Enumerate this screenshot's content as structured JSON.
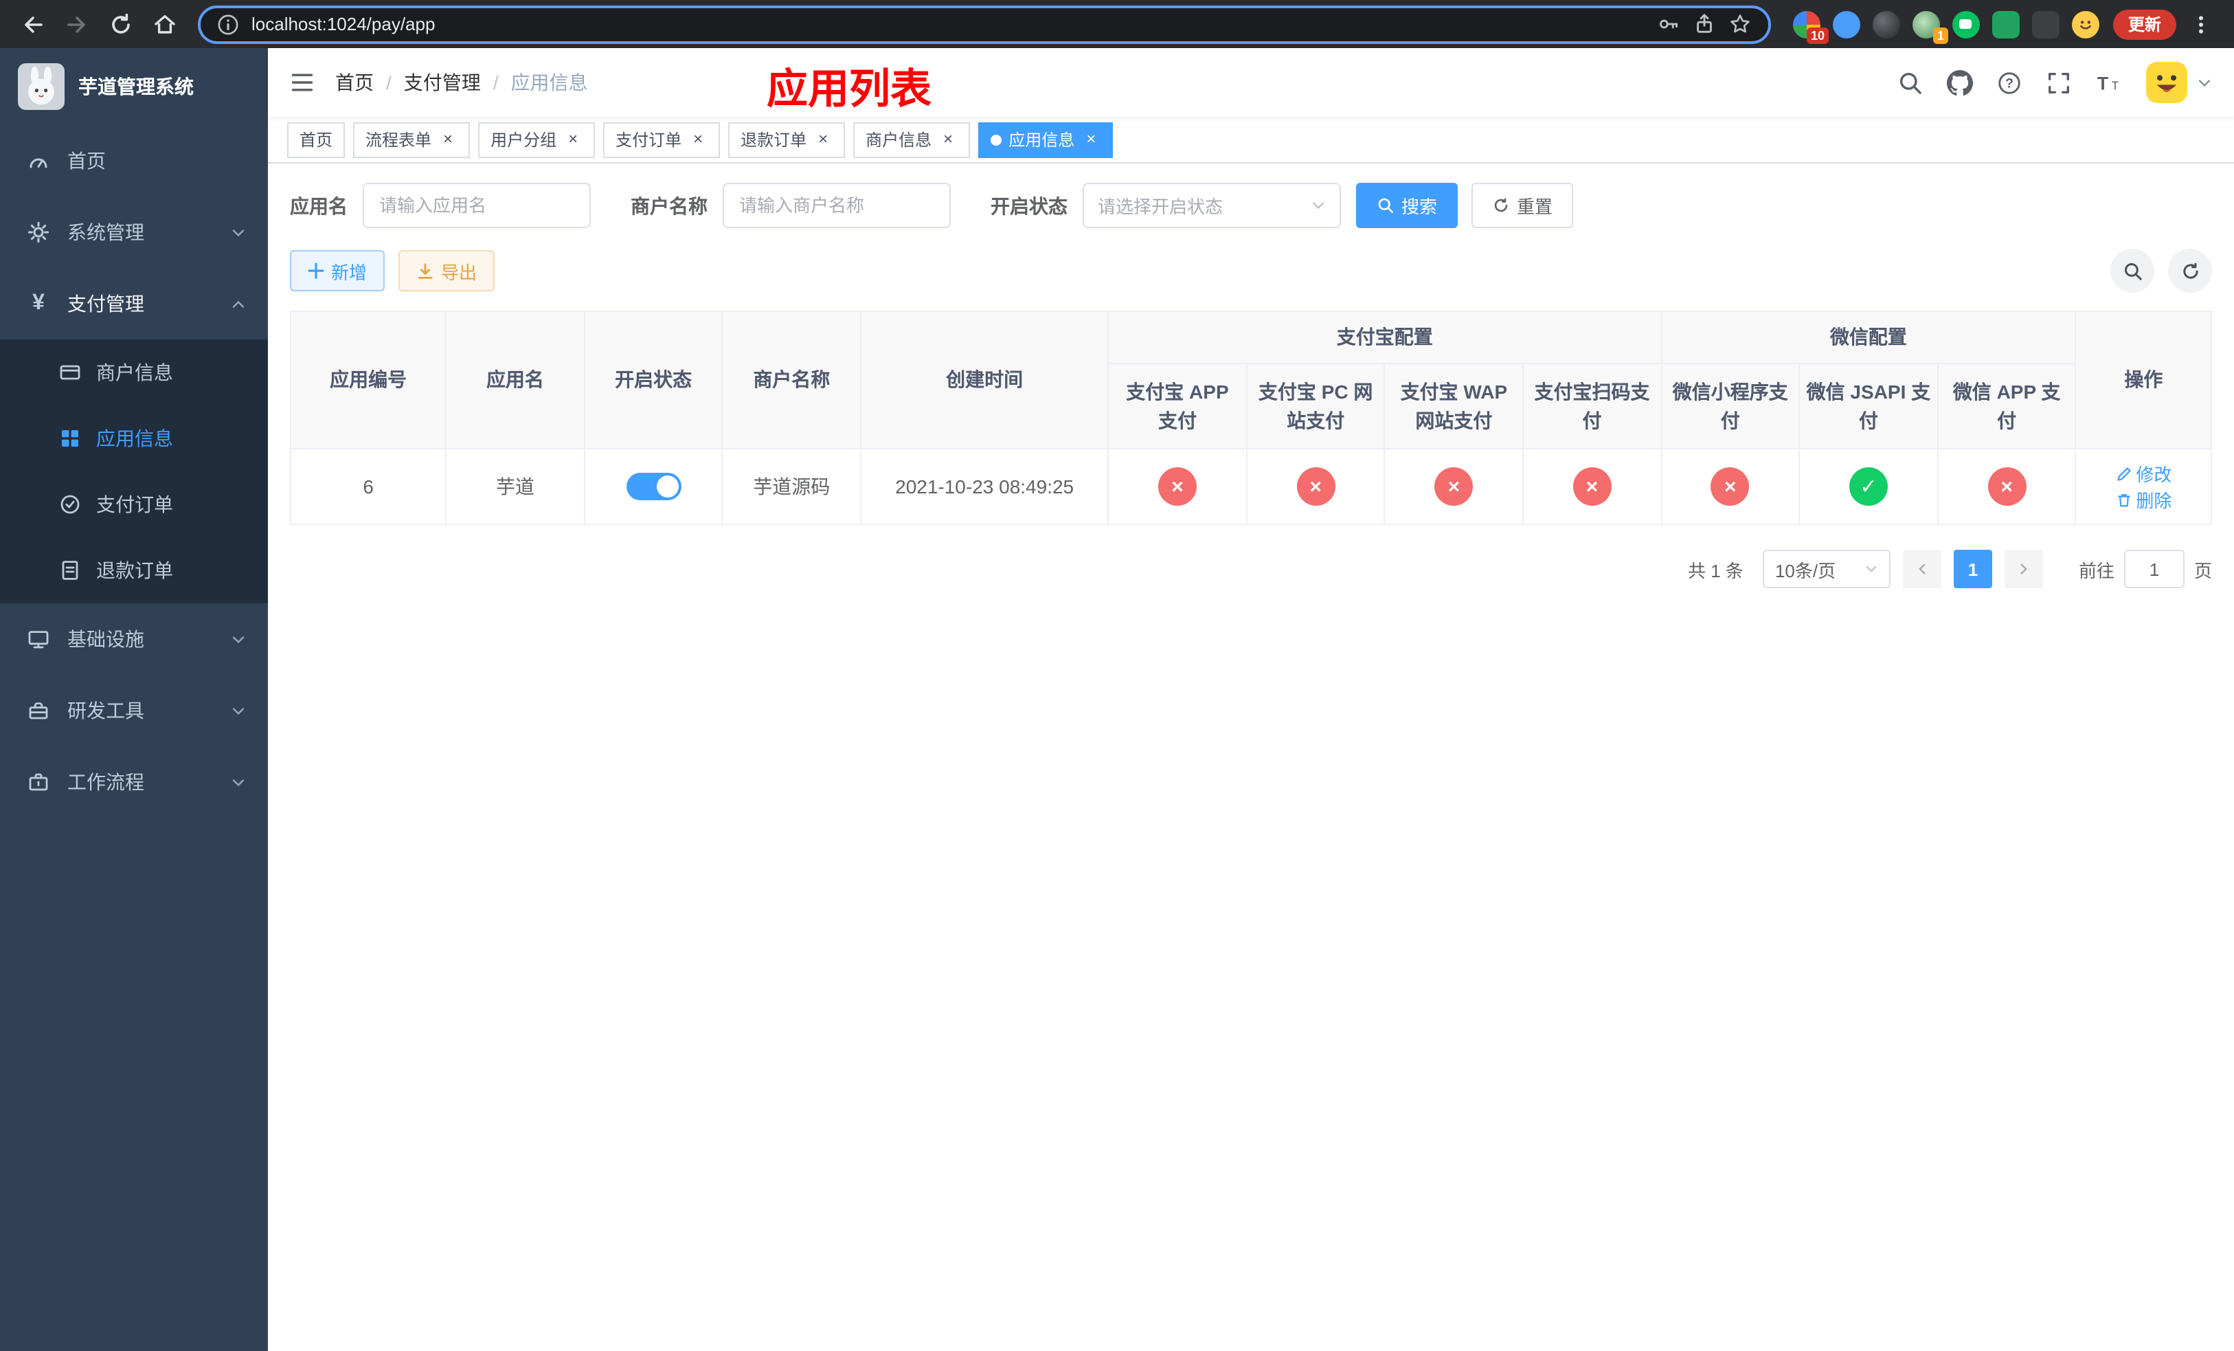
{
  "browser": {
    "url": "localhost:1024/pay/app",
    "update_button": "更新",
    "extension_badges": {
      "first": "10",
      "second": "1"
    }
  },
  "sidebar": {
    "logo_title": "芋道管理系统",
    "menu": [
      {
        "label": "首页"
      },
      {
        "label": "系统管理"
      },
      {
        "label": "支付管理"
      },
      {
        "label": "基础设施"
      },
      {
        "label": "研发工具"
      },
      {
        "label": "工作流程"
      }
    ],
    "payment_submenu": [
      {
        "label": "商户信息"
      },
      {
        "label": "应用信息"
      },
      {
        "label": "支付订单"
      },
      {
        "label": "退款订单"
      }
    ]
  },
  "navbar": {
    "breadcrumb": [
      "首页",
      "支付管理",
      "应用信息"
    ],
    "separator": "/",
    "overlay_title": "应用列表"
  },
  "tabs": [
    {
      "label": "首页"
    },
    {
      "label": "流程表单"
    },
    {
      "label": "用户分组"
    },
    {
      "label": "支付订单"
    },
    {
      "label": "退款订单"
    },
    {
      "label": "商户信息"
    },
    {
      "label": "应用信息"
    }
  ],
  "filters": {
    "app_name_label": "应用名",
    "app_name_placeholder": "请输入应用名",
    "merchant_label": "商户名称",
    "merchant_placeholder": "请输入商户名称",
    "status_label": "开启状态",
    "status_placeholder": "请选择开启状态",
    "search_button": "搜索",
    "reset_button": "重置"
  },
  "toolbar": {
    "add_button": "新增",
    "export_button": "导出"
  },
  "table": {
    "group_headers": {
      "alipay": "支付宝配置",
      "wechat": "微信配置"
    },
    "columns": [
      "应用编号",
      "应用名",
      "开启状态",
      "商户名称",
      "创建时间",
      "支付宝 APP 支付",
      "支付宝 PC 网站支付",
      "支付宝 WAP 网站支付",
      "支付宝扫码支付",
      "微信小程序支付",
      "微信 JSAPI 支付",
      "微信 APP 支付",
      "操作"
    ],
    "rows": [
      {
        "id": "6",
        "name": "芋道",
        "enabled": true,
        "merchant": "芋道源码",
        "created_at": "2021-10-23 08:49:25",
        "configs": [
          false,
          false,
          false,
          false,
          false,
          true,
          false
        ],
        "edit_label": "修改",
        "delete_label": "删除"
      }
    ]
  },
  "status_glyphs": {
    "enabled": "✓",
    "disabled": "×"
  },
  "pagination": {
    "total_text": "共 1 条",
    "page_size": "10条/页",
    "current_page": "1",
    "goto_prefix": "前往",
    "goto_value": "1",
    "goto_suffix": "页"
  }
}
